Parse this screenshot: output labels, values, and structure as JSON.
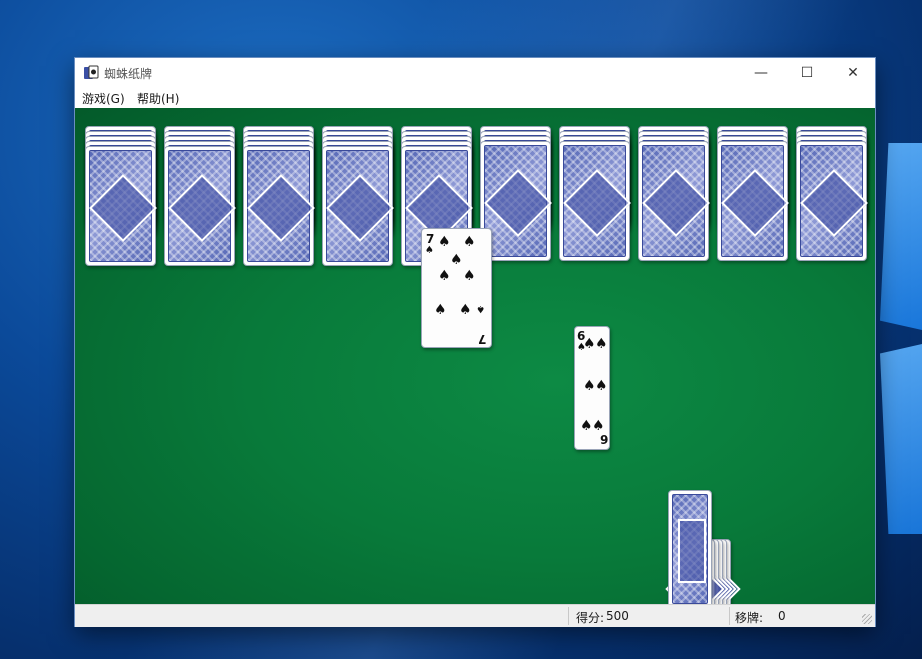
{
  "window": {
    "title": "蜘蛛纸牌",
    "controls": {
      "minimize": "—",
      "maximize": "☐",
      "close": "✕"
    }
  },
  "menu": {
    "items": [
      "游戏(G)",
      "帮助(H)"
    ]
  },
  "tableau": {
    "columns": 10,
    "cards": [
      {
        "rank": "7",
        "suit": "♠"
      },
      {
        "rank": "6",
        "suit": "♠"
      }
    ]
  },
  "status": {
    "score_label": "得分:",
    "score_value": "500",
    "moves_label": "移牌:",
    "moves_value": "0"
  },
  "colors": {
    "felt": "#087a3a",
    "card_back": "#5668b6"
  }
}
